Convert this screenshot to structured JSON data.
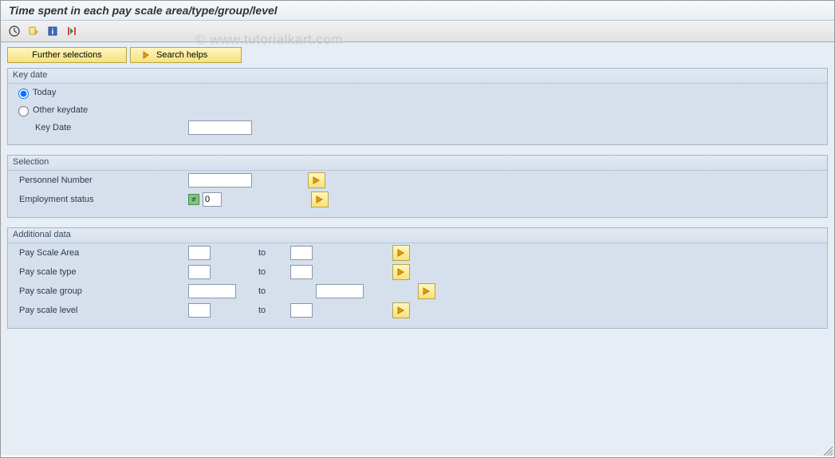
{
  "title": "Time spent in each pay scale area/type/group/level",
  "watermark": "© www.tutorialkart.com",
  "buttons": {
    "further_selections": "Further selections",
    "search_helps": "Search helps"
  },
  "groups": {
    "keydate": {
      "title": "Key date",
      "today_label": "Today",
      "other_keydate_label": "Other keydate",
      "keydate_field_label": "Key Date",
      "keydate_value": ""
    },
    "selection": {
      "title": "Selection",
      "personnel_number_label": "Personnel Number",
      "personnel_number_value": "",
      "employment_status_label": "Employment status",
      "employment_status_value": "0"
    },
    "additional": {
      "title": "Additional data",
      "to_label": "to",
      "rows": [
        {
          "label": "Pay Scale Area",
          "from": "",
          "to": ""
        },
        {
          "label": "Pay scale type",
          "from": "",
          "to": ""
        },
        {
          "label": "Pay scale group",
          "from": "",
          "to": ""
        },
        {
          "label": "Pay scale level",
          "from": "",
          "to": ""
        }
      ]
    }
  }
}
